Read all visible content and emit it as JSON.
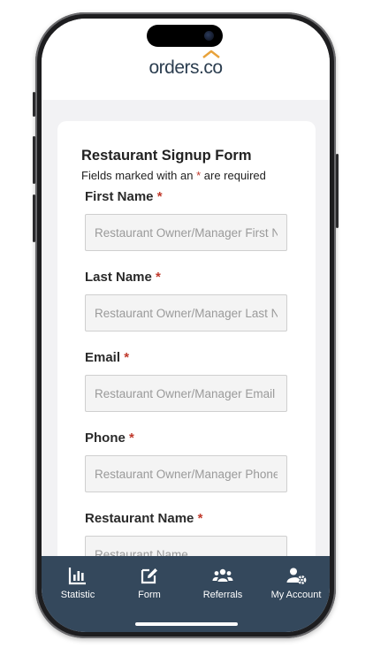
{
  "brand": {
    "logo_text_main": "orders",
    "logo_text_dot": ".",
    "logo_text_tail": "co",
    "accent": "#e8a23a",
    "text_color": "#2c3e50"
  },
  "form": {
    "title": "Restaurant Signup Form",
    "subtitle_prefix": "Fields marked with an",
    "subtitle_star": "*",
    "subtitle_suffix": "are required",
    "required_marker": "*",
    "fields": [
      {
        "label": "First Name",
        "placeholder": "Restaurant Owner/Manager First Name",
        "value": ""
      },
      {
        "label": "Last Name",
        "placeholder": "Restaurant Owner/Manager Last Name",
        "value": ""
      },
      {
        "label": "Email",
        "placeholder": "Restaurant Owner/Manager Email Address",
        "value": ""
      },
      {
        "label": "Phone",
        "placeholder": "Restaurant Owner/Manager Phone",
        "value": ""
      },
      {
        "label": "Restaurant Name",
        "placeholder": "Restaurant Name",
        "value": ""
      }
    ]
  },
  "tabbar": {
    "background": "#34485c",
    "items": [
      {
        "label": "Statistic",
        "icon": "bar-chart-icon"
      },
      {
        "label": "Form",
        "icon": "edit-icon"
      },
      {
        "label": "Referrals",
        "icon": "users-icon"
      },
      {
        "label": "My Account",
        "icon": "user-gear-icon"
      }
    ]
  }
}
